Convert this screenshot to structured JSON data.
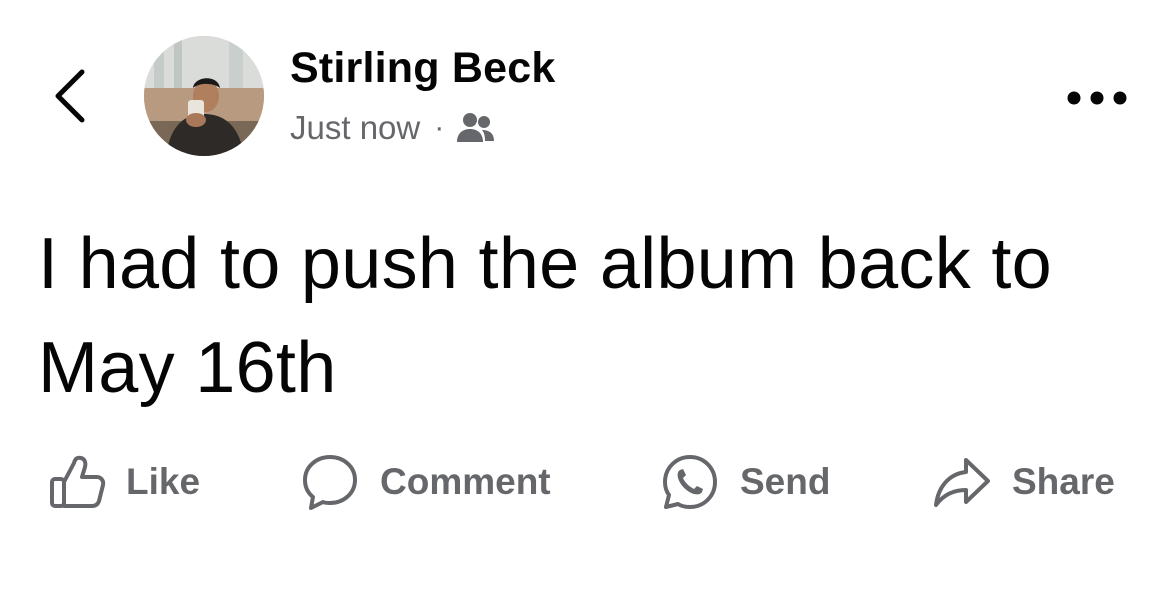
{
  "post": {
    "author": "Stirling Beck",
    "timestamp": "Just now",
    "separator": "·",
    "audience_icon": "friends-icon",
    "text": "I had to push the album back to May 16th"
  },
  "header": {
    "back_icon": "chevron-left-icon",
    "more_icon": "more-horizontal-icon"
  },
  "actions": {
    "like": "Like",
    "comment": "Comment",
    "send": "Send",
    "share": "Share"
  },
  "colors": {
    "primary_text": "#050505",
    "secondary_text": "#65676b",
    "background": "#ffffff"
  }
}
